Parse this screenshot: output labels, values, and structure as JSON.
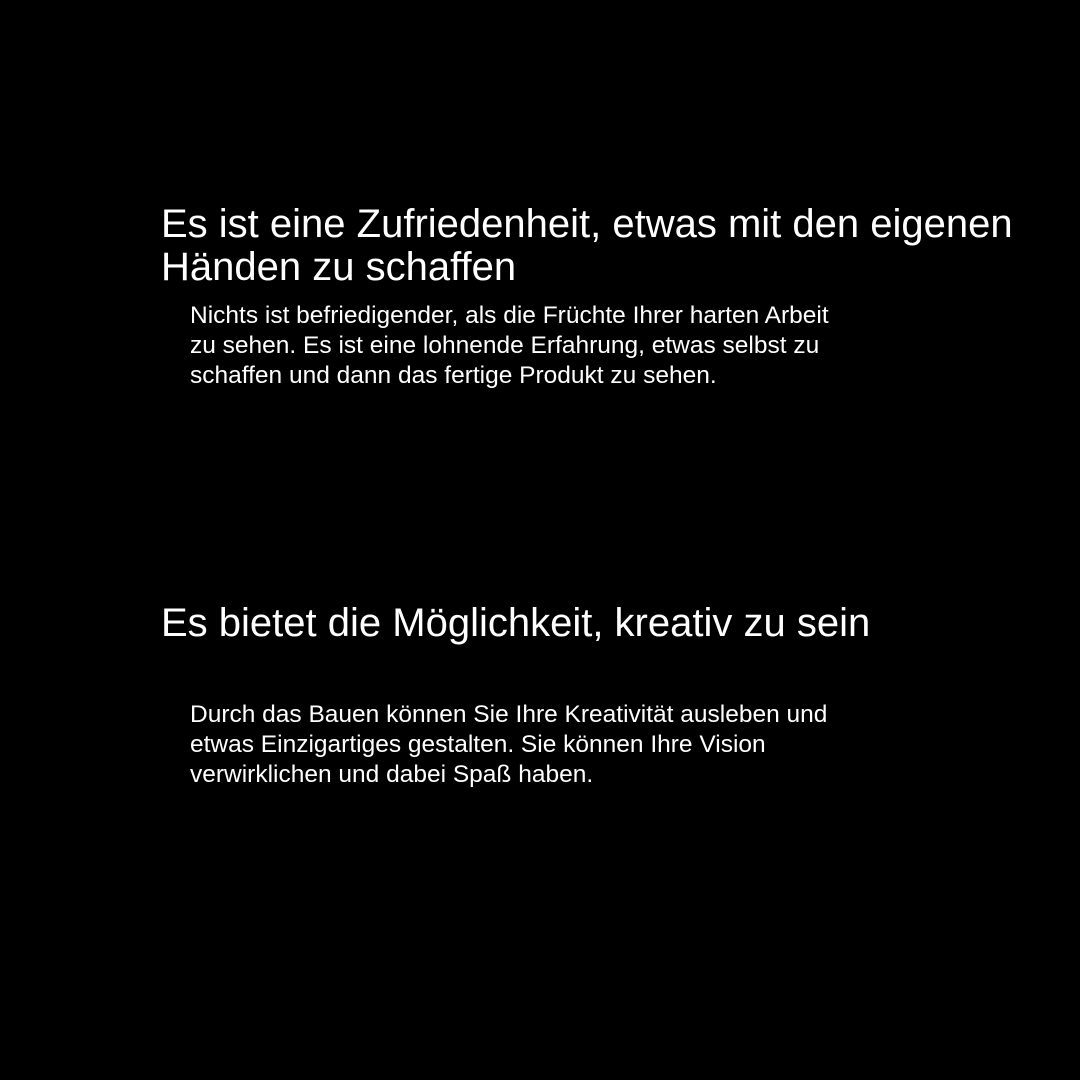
{
  "colors": {
    "background": "#000000",
    "text": "#ffffff"
  },
  "sections": [
    {
      "heading": "Es ist eine Zufriedenheit, etwas mit den eigenen Händen zu schaffen",
      "body": "Nichts ist befriedigender, als die Früchte Ihrer harten Arbeit zu sehen. Es ist eine lohnende Erfahrung, etwas selbst zu schaffen und dann das fertige Produkt zu sehen."
    },
    {
      "heading": "Es bietet die Möglichkeit, kreativ zu sein",
      "body": "Durch das Bauen können Sie Ihre Kreativität ausleben und etwas Einzigartiges gestalten. Sie können Ihre Vision verwirklichen und dabei Spaß haben."
    }
  ]
}
